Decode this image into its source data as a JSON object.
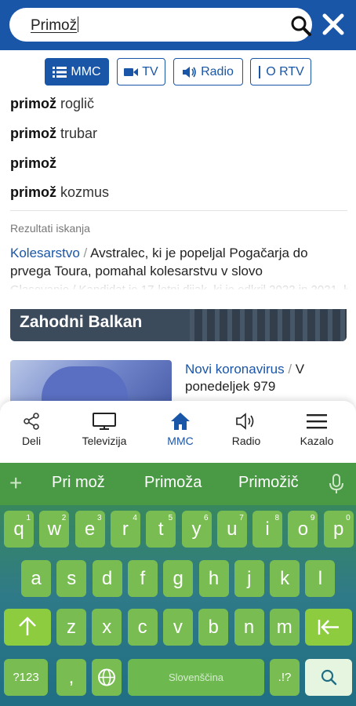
{
  "search": {
    "query": "Primož"
  },
  "filters": [
    {
      "label": "MMC"
    },
    {
      "label": "TV"
    },
    {
      "label": "Radio"
    },
    {
      "label": "O RTV"
    }
  ],
  "suggestions": [
    {
      "bold": "primož",
      "rest": " roglič"
    },
    {
      "bold": "primož",
      "rest": " trubar"
    },
    {
      "bold": "primož",
      "rest": ""
    },
    {
      "bold": "primož",
      "rest": " kozmus"
    }
  ],
  "results": {
    "label": "Rezultati iskanja",
    "first": {
      "category": "Kolesarstvo",
      "separator": " / ",
      "title": "Avstralec, ki je popeljal Pogačarja do prvega Toura, pomahal kolesarstvu v slovo"
    },
    "partial_next": "Oh..."
  },
  "background": {
    "banner": "Zahodni Balkan",
    "article": {
      "category": "Novi koronavirus",
      "separator": " / ",
      "title": "V ponedeljek 979"
    }
  },
  "bottom_nav": [
    {
      "label": "Deli",
      "icon": "share-icon"
    },
    {
      "label": "Televizija",
      "icon": "tv-icon"
    },
    {
      "label": "MMC",
      "icon": "home-icon",
      "active": true
    },
    {
      "label": "Radio",
      "icon": "speaker-icon"
    },
    {
      "label": "Kazalo",
      "icon": "menu-icon"
    }
  ],
  "keyboard": {
    "suggestions": [
      "Pri mož",
      "Primoža",
      "Primožič"
    ],
    "row1": [
      {
        "k": "q",
        "n": "1"
      },
      {
        "k": "w",
        "n": "2"
      },
      {
        "k": "e",
        "n": "3"
      },
      {
        "k": "r",
        "n": "4"
      },
      {
        "k": "t",
        "n": "5"
      },
      {
        "k": "y",
        "n": "6"
      },
      {
        "k": "u",
        "n": "7"
      },
      {
        "k": "i",
        "n": "8"
      },
      {
        "k": "o",
        "n": "9"
      },
      {
        "k": "p",
        "n": "0"
      }
    ],
    "row2": [
      "a",
      "s",
      "d",
      "f",
      "g",
      "h",
      "j",
      "k",
      "l"
    ],
    "row3": [
      "z",
      "x",
      "c",
      "v",
      "b",
      "n",
      "m"
    ],
    "sym_label": "?123",
    "punct_label": ",",
    "space_label": "Slovenščina",
    "punct2_label": ".!?",
    "colors": {
      "key": "#79bd52",
      "accent": "#8ccc3e",
      "brand_blue": "#1a56a8"
    }
  }
}
